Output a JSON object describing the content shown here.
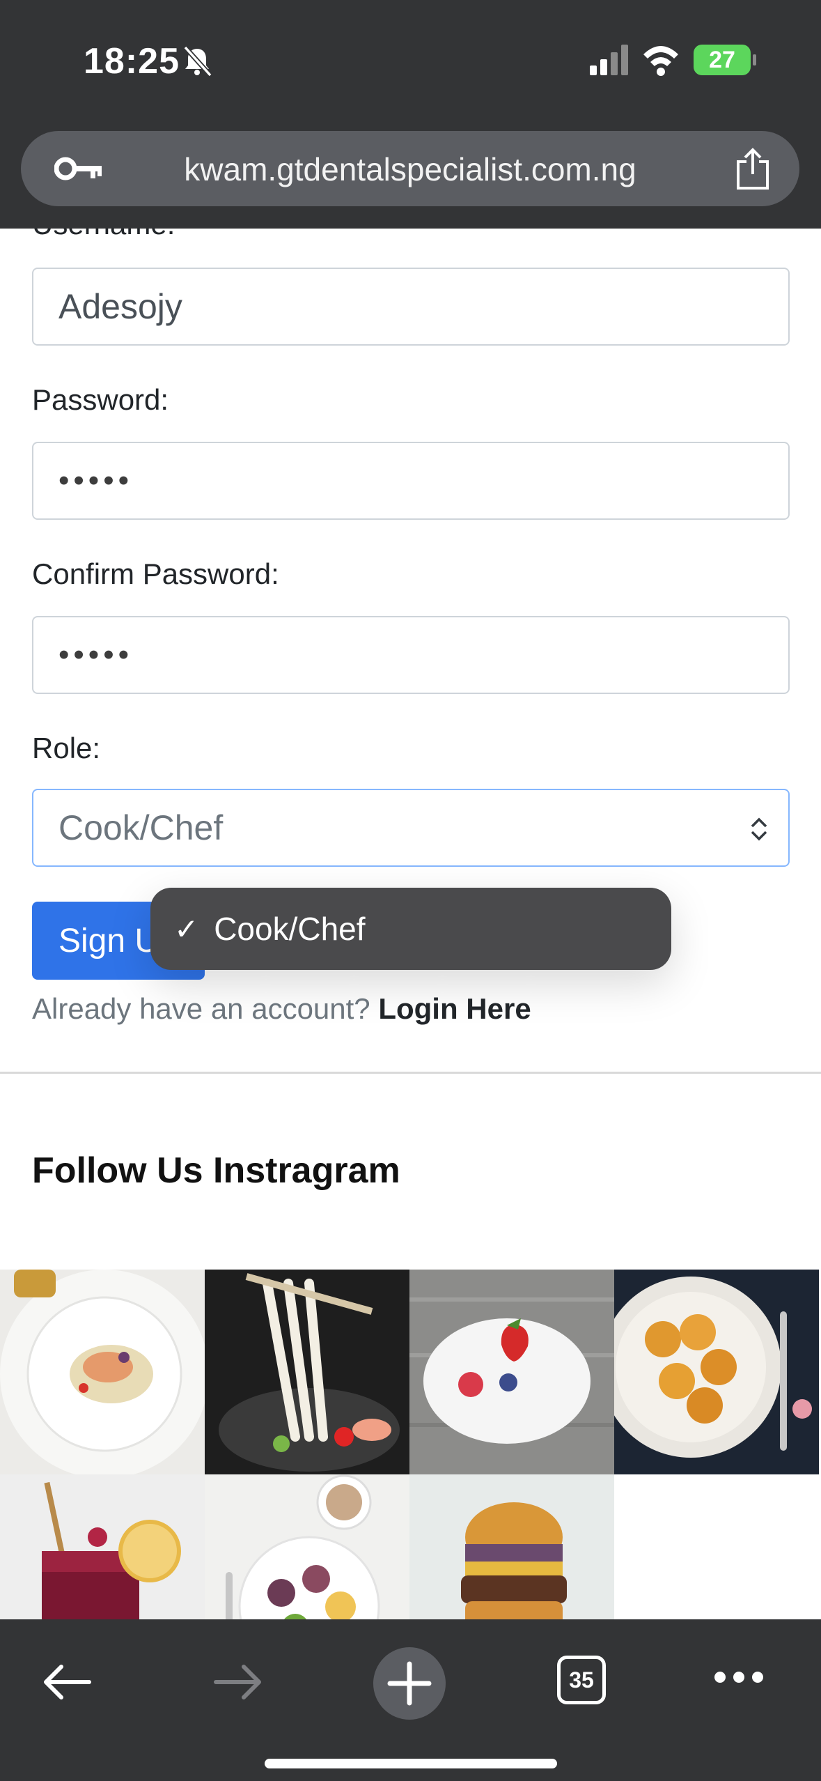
{
  "status_bar": {
    "time": "18:25",
    "battery": "27"
  },
  "browser": {
    "url": "kwam.gtdentalspecialist.com.ng",
    "tabs_count": "35"
  },
  "form": {
    "username_label": "Username:",
    "username_value": "Adesojy",
    "password_label": "Password:",
    "password_value": "•••••",
    "confirm_label": "Confirm Password:",
    "confirm_value": "•••••",
    "role_label": "Role:",
    "role_value": "Cook/Chef",
    "signup_label": "Sign Up",
    "already_text": "Already have an account?",
    "login_link": "Login Here"
  },
  "dropdown": {
    "options": [
      {
        "label": "Cook/Chef",
        "selected": true
      }
    ]
  },
  "instagram": {
    "heading": "Follow Us Instragram",
    "images": [
      "salmon-plate",
      "noodles-chopsticks",
      "berries-plate",
      "apricot-plate",
      "berry-drink",
      "fruit-bowl",
      "burger"
    ]
  },
  "colors": {
    "primary": "#2f73e8",
    "chrome": "#333436",
    "battery": "#5cd65c"
  }
}
